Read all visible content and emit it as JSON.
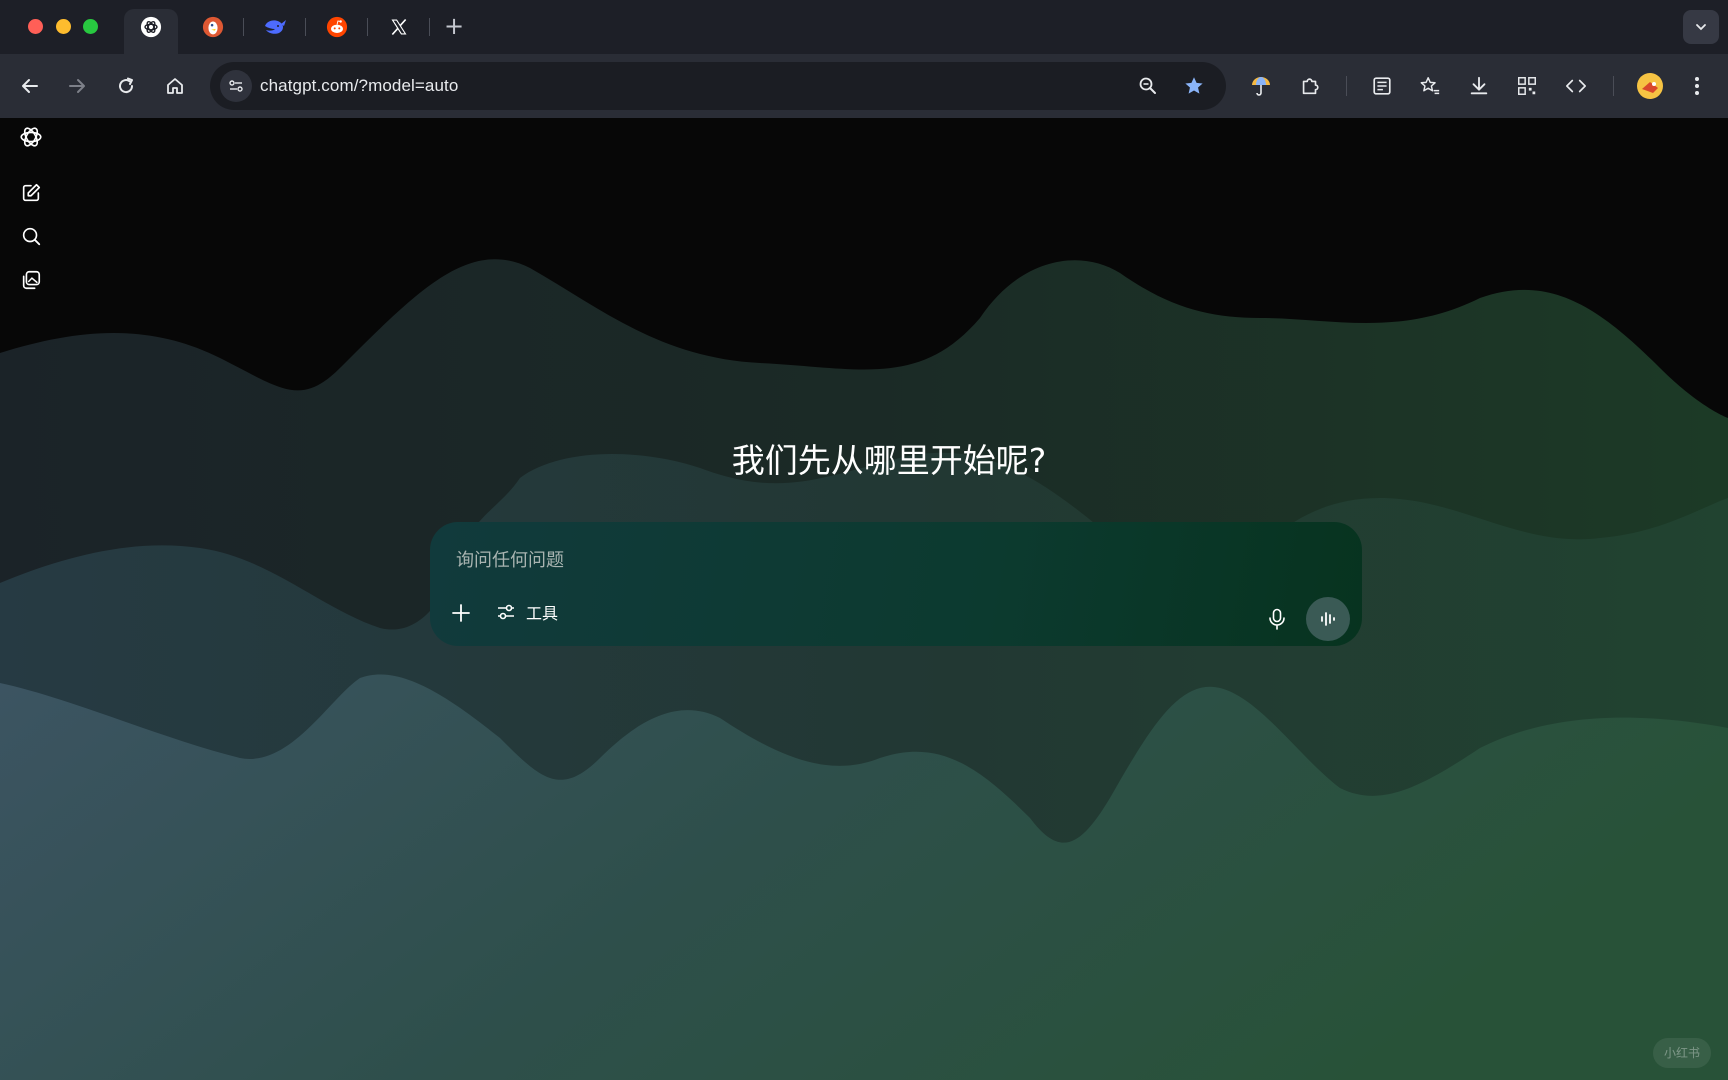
{
  "browser": {
    "tabs": [
      {
        "site": "ChatGPT",
        "icon": "openai-logo-icon",
        "active": true
      },
      {
        "site": "DuckDuckGo",
        "icon": "duckduckgo-icon",
        "active": false
      },
      {
        "site": "DeepSeek",
        "icon": "deepseek-whale-icon",
        "active": false
      },
      {
        "site": "Reddit",
        "icon": "reddit-icon",
        "active": false
      },
      {
        "site": "X",
        "icon": "x-logo-icon",
        "active": false
      }
    ],
    "new_tab_label": "+",
    "address_bar": {
      "url": "chatgpt.com/?model=auto"
    }
  },
  "page": {
    "headline": "我们先从哪里开始呢?",
    "composer": {
      "placeholder": "询问任何问题",
      "tools_label": "工具"
    },
    "watermark": "小红书"
  },
  "colors": {
    "accent_star": "#8ab4f8",
    "composer_bg": "#0c3a2f",
    "reddit": "#ff4500",
    "duckduckgo": "#de5833",
    "deepseek": "#4d6bfe"
  }
}
